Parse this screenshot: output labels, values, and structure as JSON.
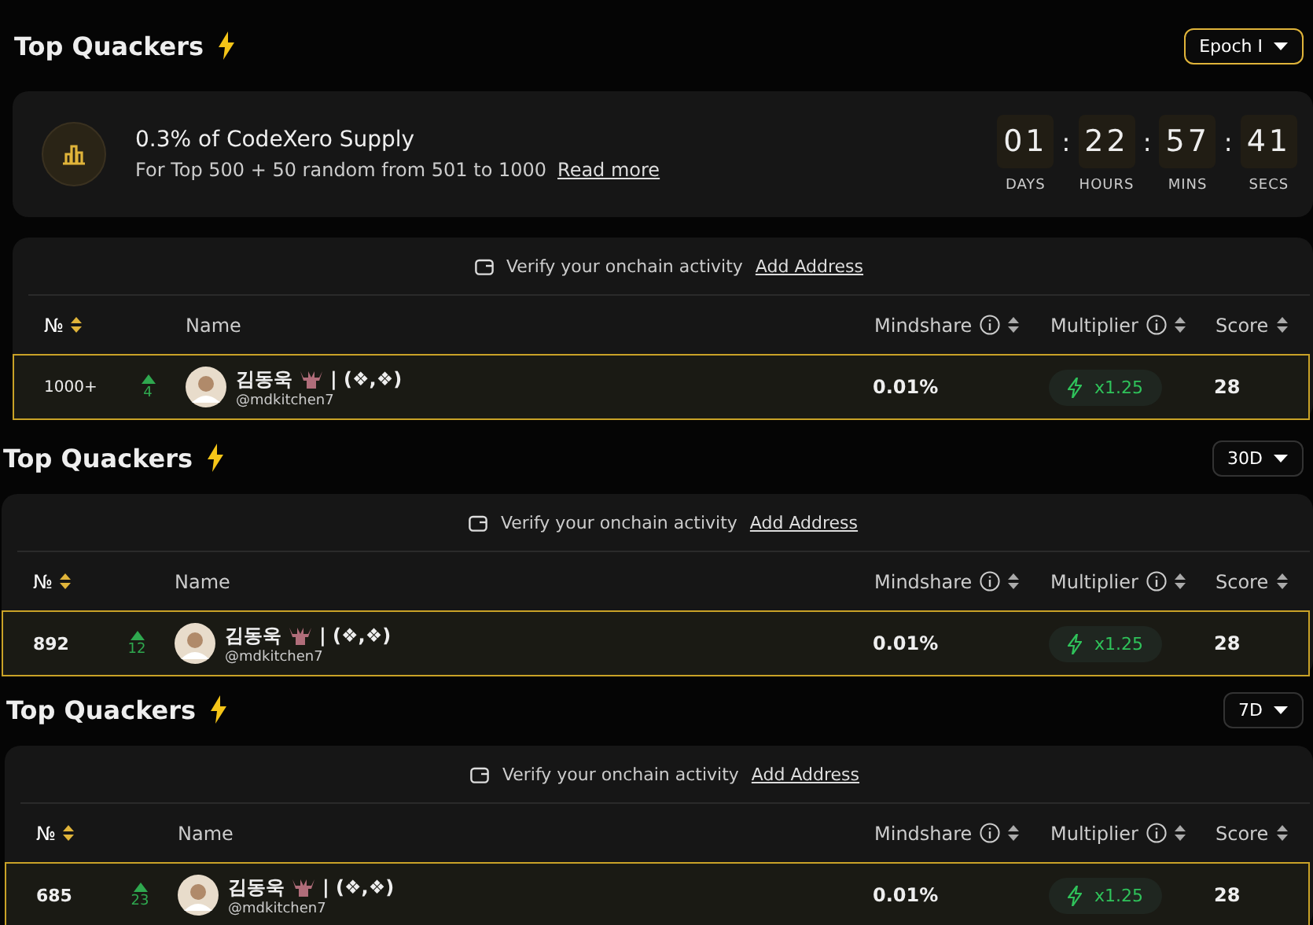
{
  "panels": [
    {
      "title": "Top Quackers",
      "period": {
        "label": "Epoch I",
        "highlighted": true
      },
      "supply": {
        "title": "0.3% of CodeXero Supply",
        "text": "For Top 500 + 50 random from 501 to 1000",
        "link": "Read more",
        "countdown": [
          {
            "value": "01",
            "unit": "DAYS"
          },
          {
            "separator": ":",
            "value": "22",
            "unit": "HOURS"
          },
          {
            "separator": ":",
            "value": "57",
            "unit": "MINS"
          },
          {
            "separator": ":",
            "value": "41",
            "unit": "SECS"
          }
        ]
      },
      "verify": {
        "text": "Verify your onchain activity",
        "link": "Add Address"
      },
      "columns": [
        {
          "label": "№",
          "info": false,
          "sortable": true,
          "sorted": true
        },
        {
          "label": "Name",
          "info": false,
          "sortable": false,
          "sorted": false
        },
        {
          "label": "Mindshare",
          "info": true,
          "sortable": true,
          "sorted": false
        },
        {
          "label": "Multiplier",
          "info": true,
          "sortable": true,
          "sorted": false
        },
        {
          "label": "Score",
          "info": false,
          "sortable": true,
          "sorted": false
        }
      ],
      "rows": [
        {
          "rank": "1000+",
          "change": "4",
          "name": "김동욱",
          "name_suffix": "| (❖,❖)",
          "handle": "@mdkitchen7",
          "mindshare": "0.01%",
          "multiplier": "x1.25",
          "score": "28",
          "highlighted": true
        }
      ]
    },
    {
      "title": "Top Quackers",
      "period": {
        "label": "30D",
        "highlighted": false
      },
      "verify": {
        "text": "Verify your onchain activity",
        "link": "Add Address"
      },
      "columns": [
        {
          "label": "№",
          "info": false,
          "sortable": true,
          "sorted": true
        },
        {
          "label": "Name",
          "info": false,
          "sortable": false,
          "sorted": false
        },
        {
          "label": "Mindshare",
          "info": true,
          "sortable": true,
          "sorted": false
        },
        {
          "label": "Multiplier",
          "info": true,
          "sortable": true,
          "sorted": false
        },
        {
          "label": "Score",
          "info": false,
          "sortable": true,
          "sorted": false
        }
      ],
      "rows": [
        {
          "rank": "892",
          "change": "12",
          "name": "김동욱",
          "name_suffix": "| (❖,❖)",
          "handle": "@mdkitchen7",
          "mindshare": "0.01%",
          "multiplier": "x1.25",
          "score": "28",
          "highlighted": true
        }
      ]
    },
    {
      "title": "Top Quackers",
      "period": {
        "label": "7D",
        "highlighted": false
      },
      "verify": {
        "text": "Verify your onchain activity",
        "link": "Add Address"
      },
      "columns": [
        {
          "label": "№",
          "info": false,
          "sortable": true,
          "sorted": true
        },
        {
          "label": "Name",
          "info": false,
          "sortable": false,
          "sorted": false
        },
        {
          "label": "Mindshare",
          "info": true,
          "sortable": true,
          "sorted": false
        },
        {
          "label": "Multiplier",
          "info": true,
          "sortable": true,
          "sorted": false
        },
        {
          "label": "Score",
          "info": false,
          "sortable": true,
          "sorted": false
        }
      ],
      "rows": [
        {
          "rank": "685",
          "change": "23",
          "name": "김동욱",
          "name_suffix": "| (❖,❖)",
          "handle": "@mdkitchen7",
          "mindshare": "0.01%",
          "multiplier": "x1.25",
          "score": "28",
          "highlighted": true
        }
      ]
    }
  ]
}
